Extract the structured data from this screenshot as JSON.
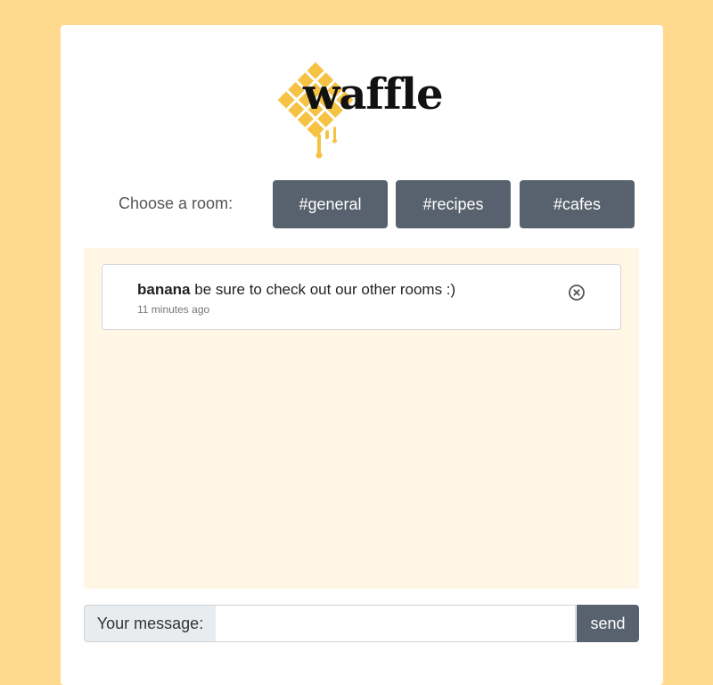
{
  "brand": {
    "name": "waffle",
    "accent_color": "#f5c243"
  },
  "rooms": {
    "label": "Choose a room:",
    "buttons": [
      "#general",
      "#recipes",
      "#cafes"
    ]
  },
  "messages": [
    {
      "author": "banana",
      "text": "be sure to check out our other rooms :)",
      "time": "11 minutes ago",
      "delete_icon": "close-circle-icon"
    }
  ],
  "composer": {
    "label": "Your message:",
    "value": "",
    "send_label": "send"
  },
  "colors": {
    "page_background": "#ffd98e",
    "messages_background": "#fff6e5",
    "button": "#57626e"
  }
}
